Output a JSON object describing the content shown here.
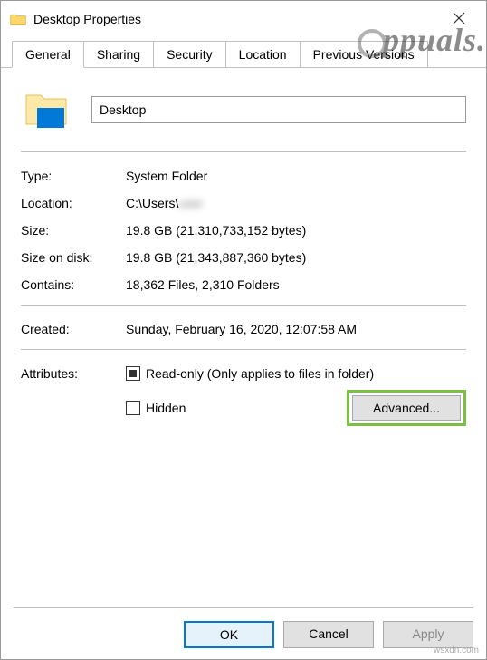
{
  "window": {
    "title": "Desktop Properties"
  },
  "tabs": {
    "items": [
      "General",
      "Sharing",
      "Security",
      "Location",
      "Previous Versions"
    ],
    "active_index": 0
  },
  "folder_name": "Desktop",
  "properties": {
    "type_label": "Type:",
    "type_value": "System Folder",
    "location_label": "Location:",
    "location_value_prefix": "C:\\Users\\",
    "location_value_user": "user",
    "size_label": "Size:",
    "size_value": "19.8 GB (21,310,733,152 bytes)",
    "size_disk_label": "Size on disk:",
    "size_disk_value": "19.8 GB (21,343,887,360 bytes)",
    "contains_label": "Contains:",
    "contains_value": "18,362 Files, 2,310 Folders",
    "created_label": "Created:",
    "created_value": "Sunday, February 16, 2020, 12:07:58 AM",
    "attributes_label": "Attributes:",
    "readonly_label": "Read-only (Only applies to files in folder)",
    "hidden_label": "Hidden",
    "advanced_button": "Advanced..."
  },
  "buttons": {
    "ok": "OK",
    "cancel": "Cancel",
    "apply": "Apply"
  },
  "watermarks": {
    "brand": "ppuals.",
    "domain": "wsxdn.com"
  }
}
